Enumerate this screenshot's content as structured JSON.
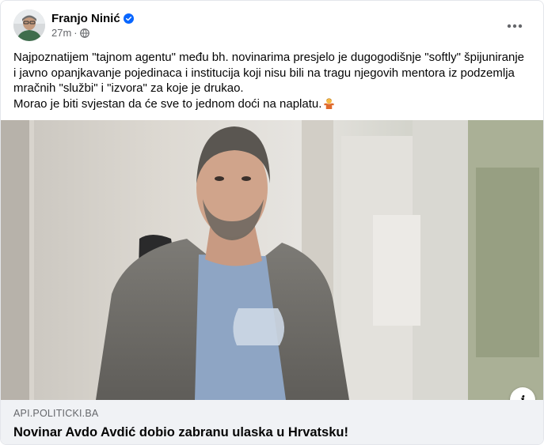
{
  "post": {
    "author": "Franjo Ninić",
    "time": "27m",
    "text_lines": [
      "Najpoznatijem \"tajnom agentu\" među bh. novinarima presjelo je dugogodišnje \"softly\" špijuniranje",
      "i javno opanjkavanje pojedinaca i institucija koji nisu bili na tragu njegovih mentora iz podzemlja",
      "mračnih \"službi\" i \"izvora\" za koje je drukao.",
      "Morao je biti svjestan da će sve to jednom doći na naplatu."
    ],
    "icons": {
      "verified": "verified-badge-icon",
      "privacy": "globe-icon",
      "more": "more-options-icon",
      "emoji": "person-shrugging-emoji",
      "info": "info-icon"
    }
  },
  "link_preview": {
    "domain": "API.POLITICKI.BA",
    "title": "Novinar Avdo Avdić dobio zabranu ulaska u Hrvatsku!",
    "info_label": "i"
  },
  "colors": {
    "verified_blue": "#0866ff",
    "secondary_text": "#65676b",
    "link_bg": "#f0f2f5"
  }
}
